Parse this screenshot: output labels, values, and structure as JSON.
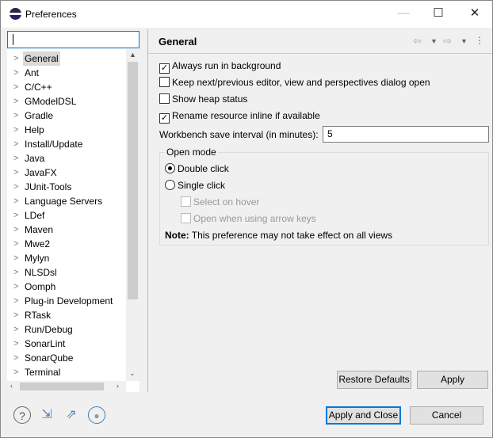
{
  "window": {
    "title": "Preferences",
    "minimize": "—",
    "maximize": "☐",
    "close": "✕"
  },
  "search": {
    "value": "",
    "placeholder": ""
  },
  "tree": {
    "selected": "General",
    "items": [
      "General",
      "Ant",
      "C/C++",
      "GModelDSL",
      "Gradle",
      "Help",
      "Install/Update",
      "Java",
      "JavaFX",
      "JUnit-Tools",
      "Language Servers",
      "LDef",
      "Maven",
      "Mwe2",
      "Mylyn",
      "NLSDsl",
      "Oomph",
      "Plug-in Development",
      "RTask",
      "Run/Debug",
      "SonarLint",
      "SonarQube",
      "Terminal"
    ]
  },
  "page": {
    "title": "General",
    "options": [
      {
        "label": "Always run in background",
        "checked": true
      },
      {
        "label": "Keep next/previous editor, view and perspectives dialog open",
        "checked": false
      },
      {
        "label": "Show heap status",
        "checked": false
      },
      {
        "label": "Rename resource inline if available",
        "checked": true
      }
    ],
    "save_interval_label": "Workbench save interval (in minutes):",
    "save_interval_value": "5",
    "open_mode": {
      "label": "Open mode",
      "double_click": "Double click",
      "single_click": "Single click",
      "selected": "Double click",
      "select_on_hover": "Select on hover",
      "open_arrow_keys": "Open when using arrow keys"
    },
    "note_label": "Note:",
    "note_text": "This preference may not take effect on all views",
    "restore_defaults": "Restore Defaults",
    "apply": "Apply"
  },
  "footer": {
    "apply_close": "Apply and Close",
    "cancel": "Cancel",
    "icons": [
      "help-icon",
      "import-icon",
      "export-icon",
      "record-icon"
    ]
  },
  "colors": {
    "accent": "#0078d7",
    "background": "#f0f0f0"
  }
}
